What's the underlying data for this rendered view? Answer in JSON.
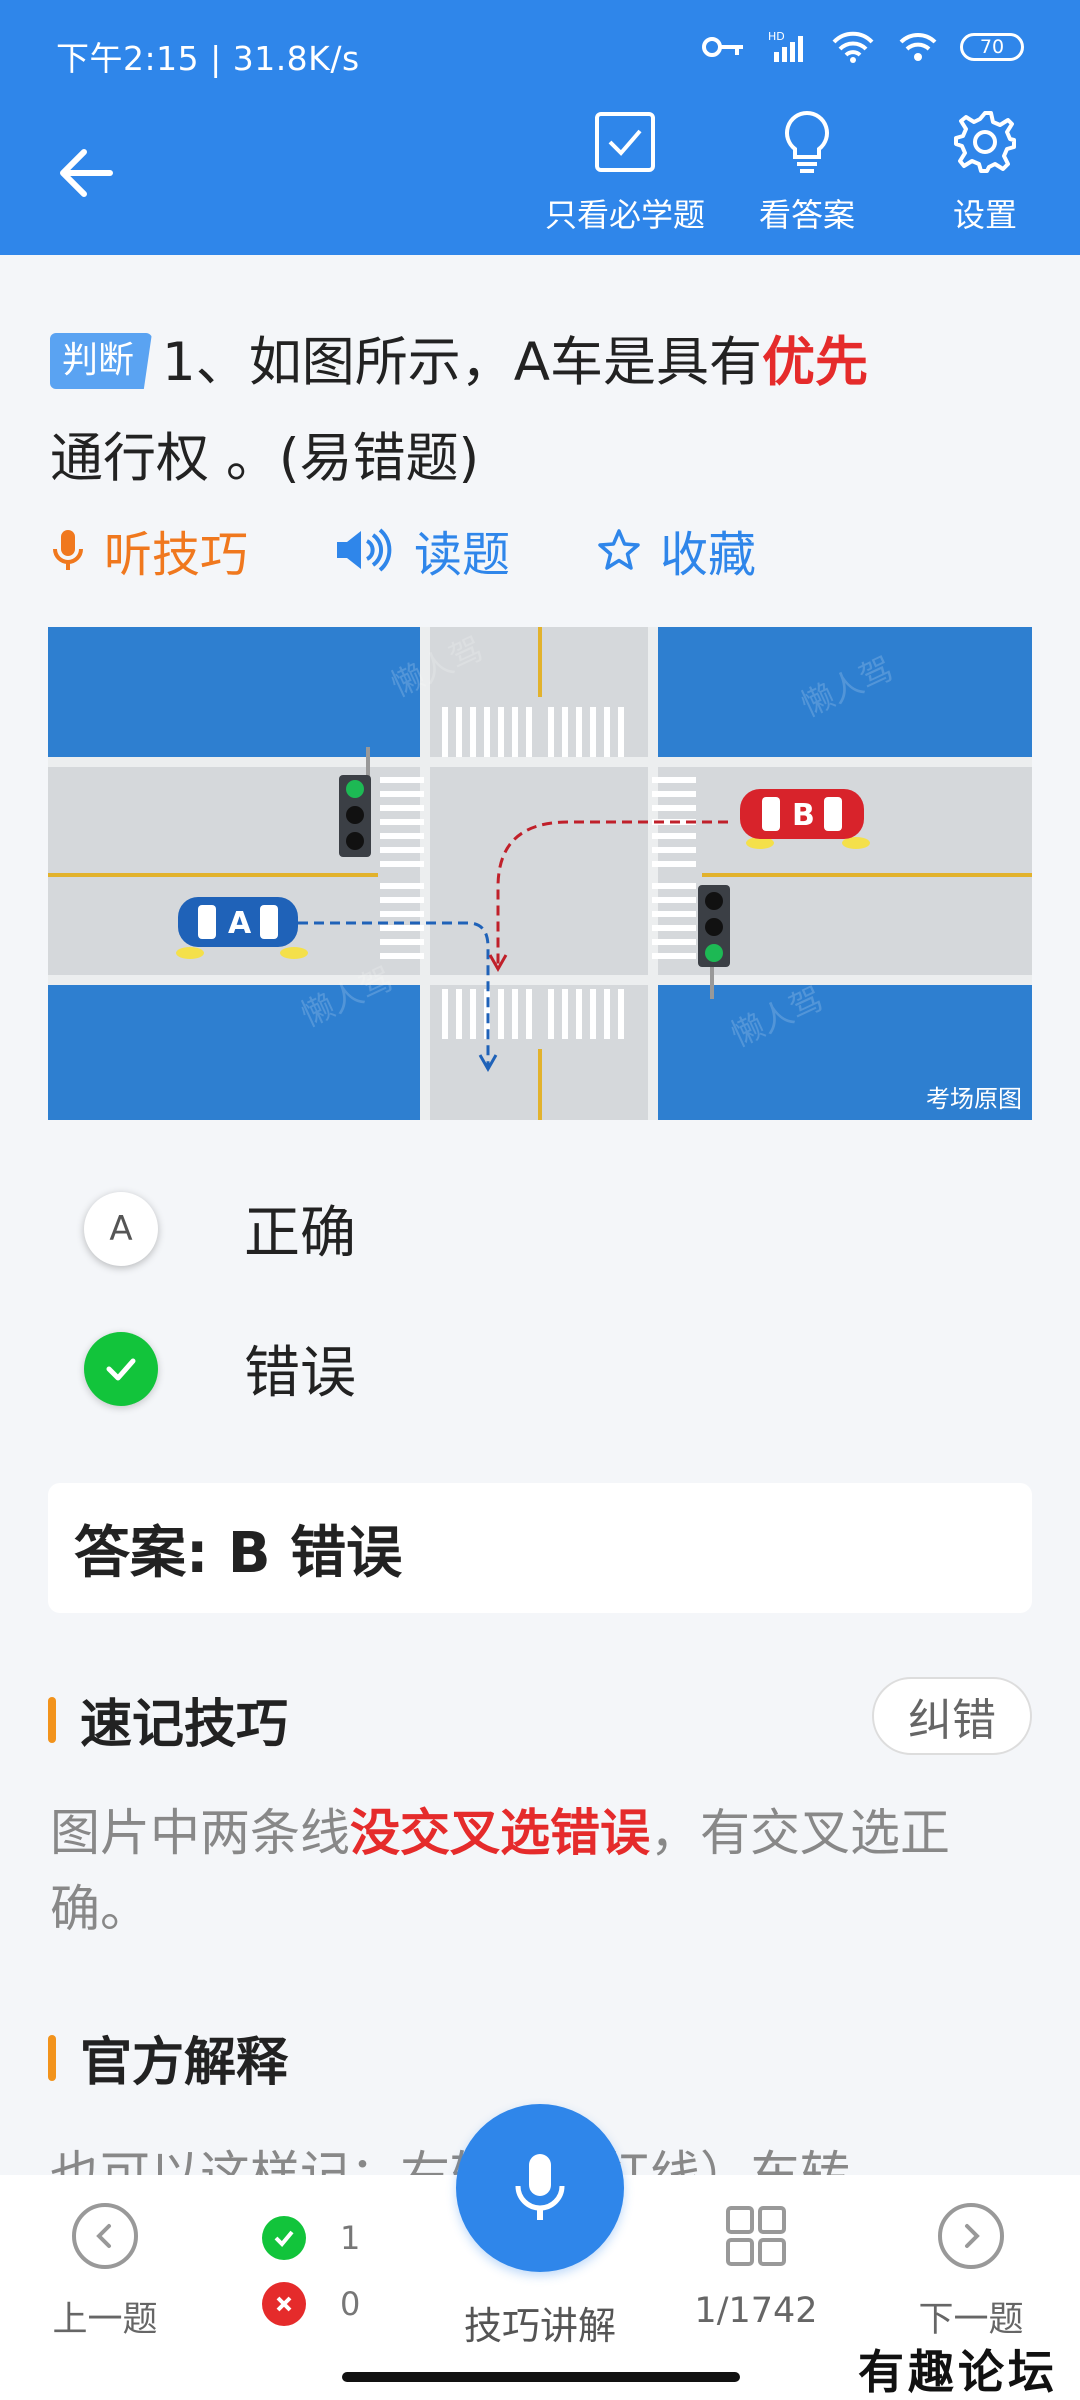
{
  "status_bar": {
    "time_net": "下午2:15 | 31.8K/s",
    "battery": "70",
    "hd": "HD"
  },
  "header": {
    "tools": [
      {
        "label": "只看必学题",
        "icon": "checkbox-icon"
      },
      {
        "label": "看答案",
        "icon": "lightbulb-icon"
      },
      {
        "label": "设置",
        "icon": "gear-icon"
      }
    ]
  },
  "question": {
    "tag": "判断",
    "text_before": "1、如图所示，A车是具有",
    "highlight": "优先",
    "text_after": "通行权 。(易错题)"
  },
  "actions": {
    "listen": "听技巧",
    "read": "读题",
    "favorite": "收藏"
  },
  "figure": {
    "caption": "考场原图",
    "car_a": "A",
    "car_b": "B",
    "watermark": "懒人驾"
  },
  "options": [
    {
      "letter": "A",
      "text": "正确",
      "state": "normal"
    },
    {
      "letter": "B",
      "text": "错误",
      "state": "correct"
    }
  ],
  "answer": {
    "text": "答案: B 错误"
  },
  "tips": {
    "title": "速记技巧",
    "correct_button": "纠错",
    "text_before": "图片中两条线",
    "highlight": "没交叉选错误",
    "text_after": "，有交叉选正确。"
  },
  "explanation": {
    "title": "官方解释",
    "text": "也可以这样记：右转弯（红线）车转"
  },
  "bottom_bar": {
    "prev": "上一题",
    "correct_count": "1",
    "wrong_count": "0",
    "mic_label": "技巧讲解",
    "progress": "1/1742",
    "next": "下一题"
  },
  "watermark": "有趣论坛",
  "colors": {
    "primary": "#2f86ea",
    "accent_red": "#e52b2b",
    "orange": "#f0781e",
    "green": "#12c43b"
  }
}
